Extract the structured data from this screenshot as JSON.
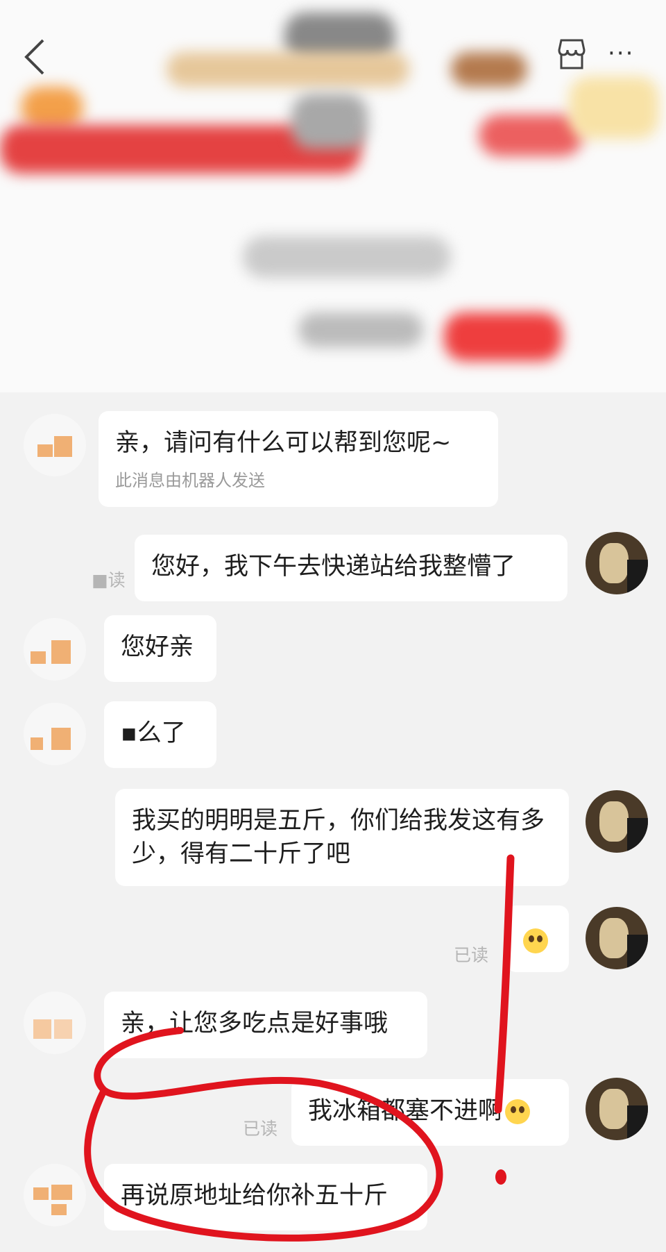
{
  "header": {
    "back_icon": "chevron-left-icon",
    "store_icon": "store-icon",
    "more_label": "···"
  },
  "chat": {
    "messages": [
      {
        "side": "left",
        "text": "亲，请问有什么可以帮到您呢~",
        "note": "此消息由机器人发送"
      },
      {
        "side": "right",
        "text": "您好，我下午去快递站给我整懵了",
        "status": "■读"
      },
      {
        "side": "left",
        "text": "您好亲"
      },
      {
        "side": "left",
        "text": "▪么了"
      },
      {
        "side": "right",
        "text": "我买的明明是五斤，你们给我发这有多少，得有二十斤了吧"
      },
      {
        "side": "right",
        "text": "",
        "emoji": "face-with-rolling-eyes-icon",
        "status": "已读"
      },
      {
        "side": "left",
        "text": "亲，让您多吃点是好事哦"
      },
      {
        "side": "right",
        "text": "我冰箱都塞不进啊",
        "emoji": "flushed-face-icon",
        "status": "已读"
      },
      {
        "side": "left",
        "text": "再说原地址给你补五十斤"
      }
    ]
  },
  "annotation": {
    "color": "#e0141e"
  }
}
